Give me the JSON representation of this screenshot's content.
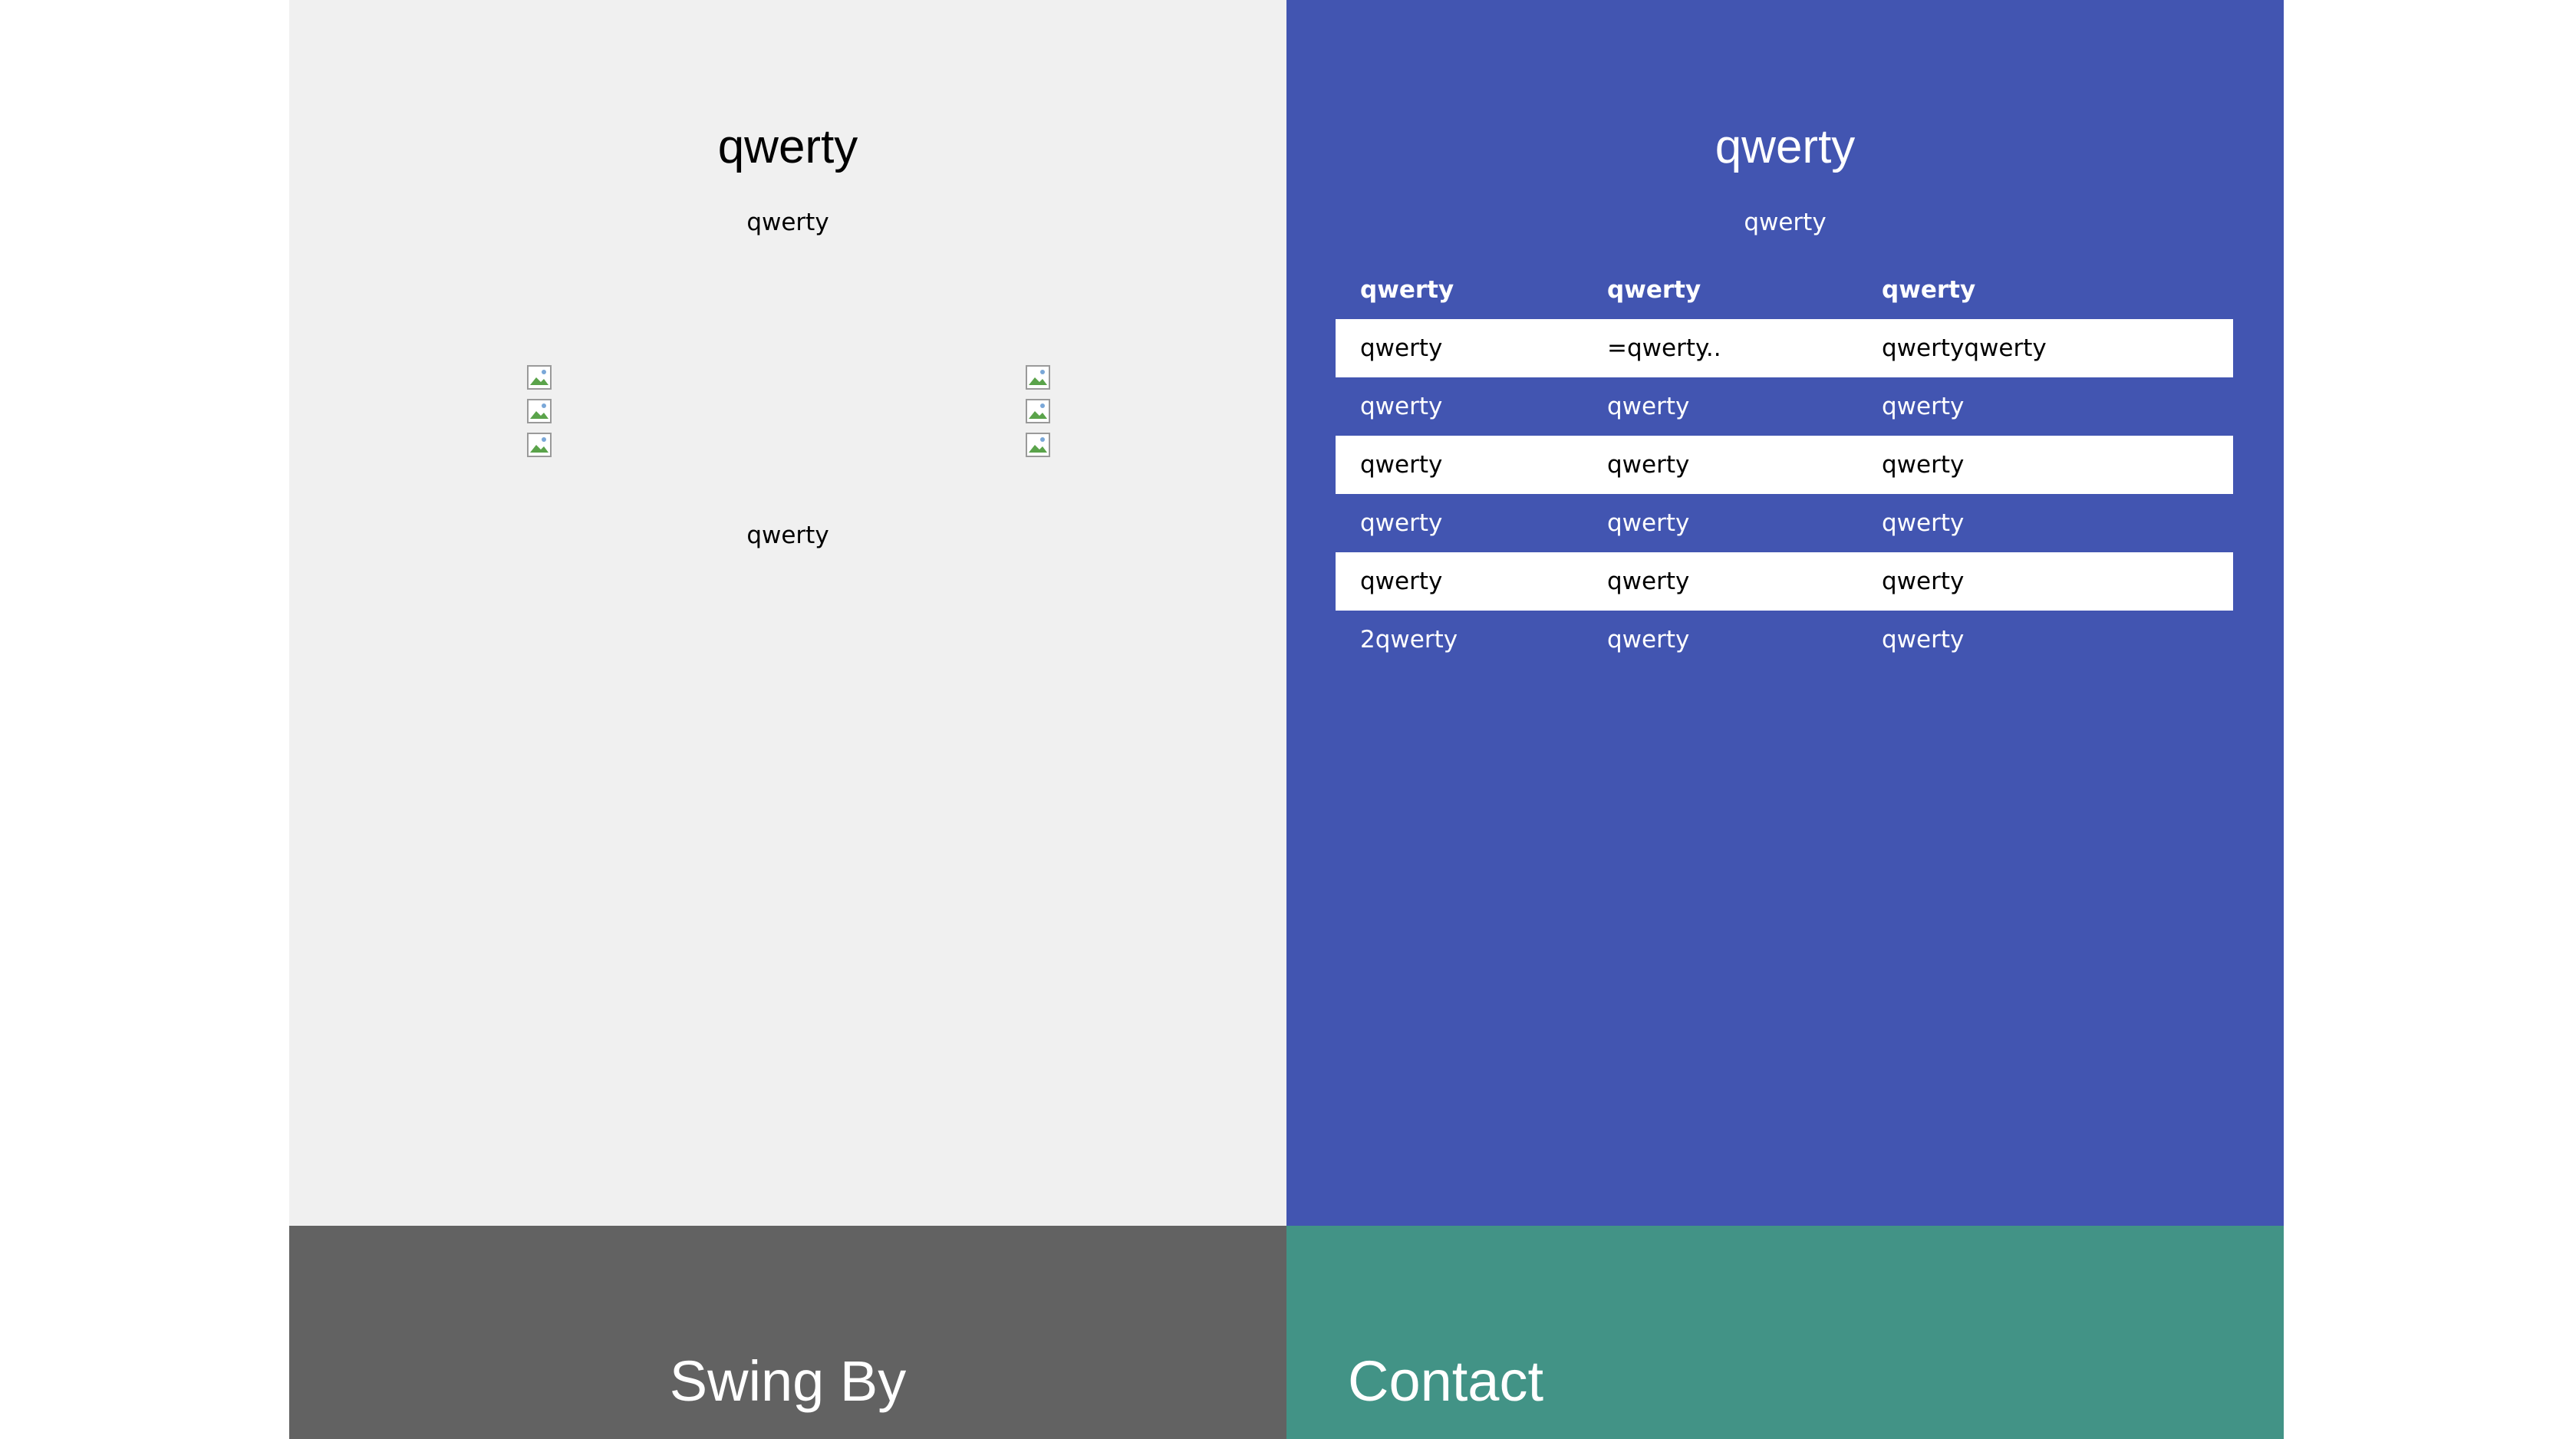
{
  "left_panel": {
    "title": "qwerty",
    "subtitle": "qwerty",
    "footer_text": "qwerty",
    "image_rows": 3
  },
  "right_panel": {
    "title": "qwerty",
    "subtitle": "qwerty",
    "table": {
      "headers": [
        "qwerty",
        "qwerty",
        "qwerty"
      ],
      "rows": [
        [
          "qwerty",
          "=qwerty..",
          "qwertyqwerty"
        ],
        [
          "qwerty",
          "qwerty",
          "qwerty"
        ],
        [
          "qwerty",
          "qwerty",
          "qwerty"
        ],
        [
          "qwerty",
          "qwerty",
          "qwerty"
        ],
        [
          "qwerty",
          "qwerty",
          "qwerty"
        ],
        [
          "2qwerty",
          "qwerty",
          "qwerty"
        ]
      ]
    }
  },
  "bottom": {
    "swing_by": "Swing By",
    "contact": "Contact"
  },
  "colors": {
    "left_bg": "#f0f0f0",
    "right_bg": "#4255b1",
    "swing_by_bg": "#626262",
    "contact_bg": "#429386"
  },
  "icons": [
    "broken-image-icon"
  ]
}
